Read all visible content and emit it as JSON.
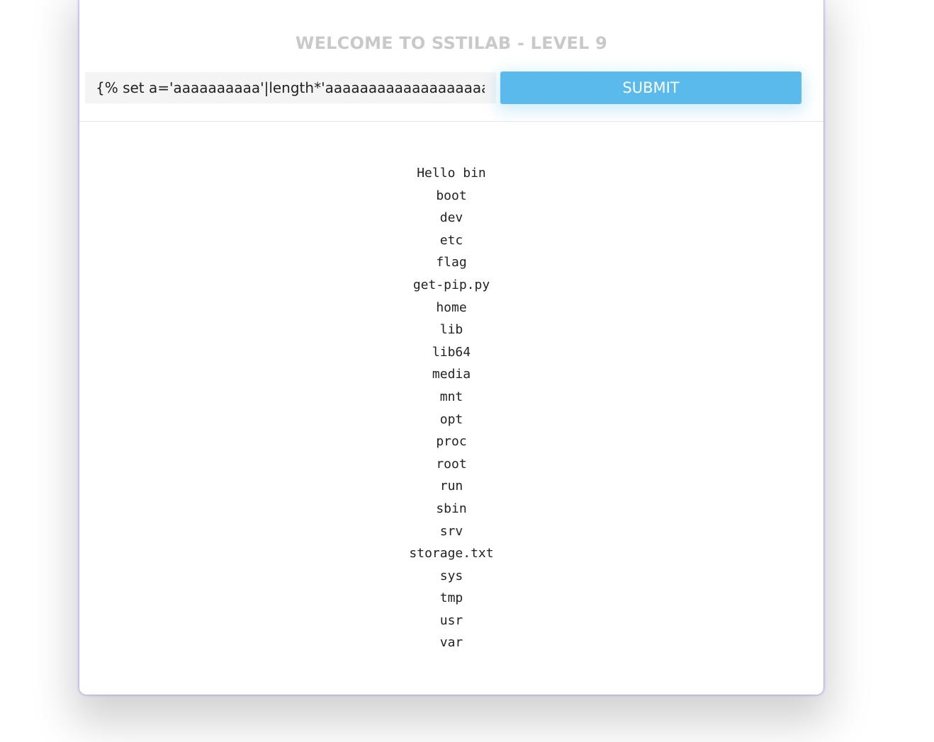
{
  "header": {
    "title": "WELCOME TO SSTILAB - LEVEL 9"
  },
  "form": {
    "query_value": "{% set a='aaaaaaaaaa'|length*'aaaaaaaaaaaaaaaaaaaa'|",
    "submit_label": "SUBMIT"
  },
  "output": {
    "lines": [
      "Hello bin",
      "boot",
      "dev",
      "etc",
      "flag",
      "get-pip.py",
      "home",
      "lib",
      "lib64",
      "media",
      "mnt",
      "opt",
      "proc",
      "root",
      "run",
      "sbin",
      "srv",
      "storage.txt",
      "sys",
      "tmp",
      "usr",
      "var"
    ]
  },
  "colors": {
    "accent": "#59baeb",
    "title": "#c9c9c9",
    "input_background": "#f4f4f4"
  }
}
